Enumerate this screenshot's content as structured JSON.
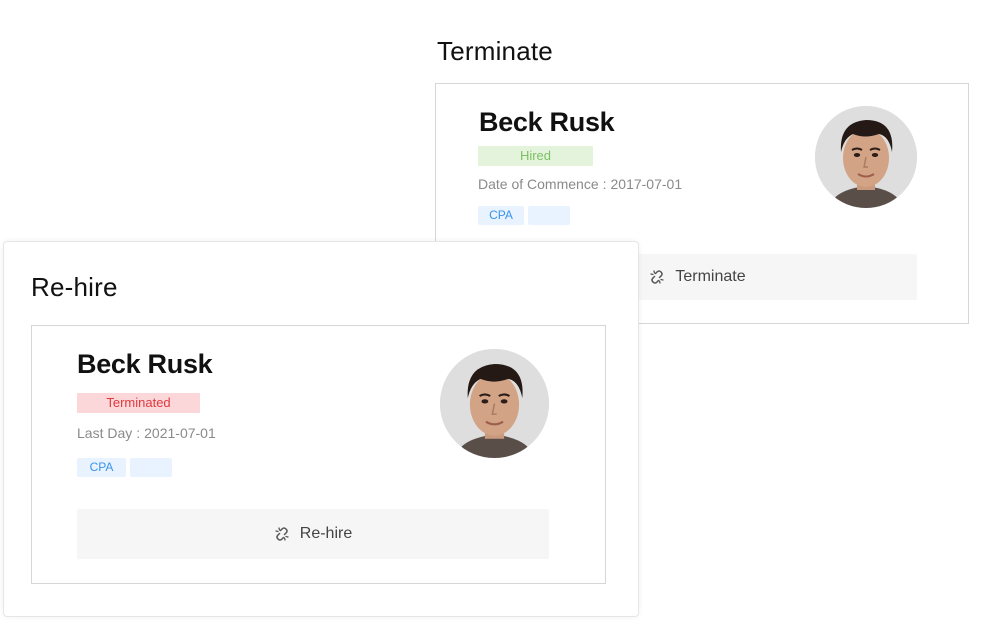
{
  "terminate": {
    "section_title": "Terminate",
    "employee_name": "Beck Rusk",
    "status_label": "Hired",
    "date_label": "Date of Commence",
    "date_separator": ":",
    "date_value": "2017-07-01",
    "tags": [
      "CPA",
      ""
    ],
    "button_label": "Terminate",
    "button_icon": "unlink-icon"
  },
  "rehire": {
    "section_title": "Re-hire",
    "employee_name": "Beck Rusk",
    "status_label": "Terminated",
    "date_label": "Last Day",
    "date_separator": ":",
    "date_value": "2021-07-01",
    "tags": [
      "CPA",
      ""
    ],
    "button_label": "Re-hire",
    "button_icon": "unlink-icon"
  },
  "colors": {
    "hired_bg": "#e4f4dc",
    "hired_text": "#7cc163",
    "terminated_bg": "#fbd7d9",
    "terminated_text": "#e0393f",
    "tag_bg": "#e8f3ff",
    "tag_text": "#3b93e8",
    "button_bg": "#f6f6f6"
  }
}
